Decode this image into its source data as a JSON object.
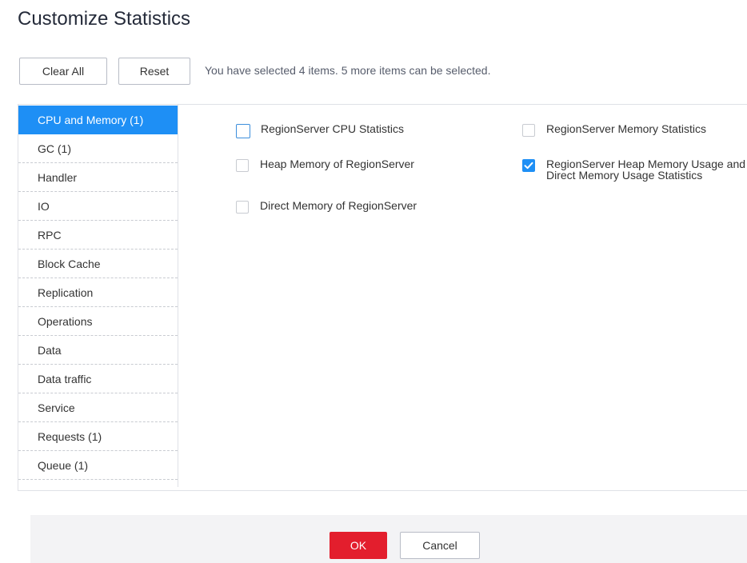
{
  "dialog": {
    "title": "Customize Statistics"
  },
  "toolbar": {
    "clear_all_label": "Clear All",
    "reset_label": "Reset",
    "selection_info": "You have selected 4 items. 5 more items can be selected."
  },
  "categories": [
    {
      "label": "CPU and Memory (1)",
      "selected": true
    },
    {
      "label": "GC (1)",
      "selected": false
    },
    {
      "label": "Handler",
      "selected": false
    },
    {
      "label": "IO",
      "selected": false
    },
    {
      "label": "RPC",
      "selected": false
    },
    {
      "label": "Block Cache",
      "selected": false
    },
    {
      "label": "Replication",
      "selected": false
    },
    {
      "label": "Operations",
      "selected": false
    },
    {
      "label": "Data",
      "selected": false
    },
    {
      "label": "Data traffic",
      "selected": false
    },
    {
      "label": "Service",
      "selected": false
    },
    {
      "label": "Requests (1)",
      "selected": false
    },
    {
      "label": "Queue (1)",
      "selected": false
    }
  ],
  "options": [
    {
      "label": "RegionServer CPU Statistics",
      "checked": false
    },
    {
      "label": "RegionServer Memory Statistics",
      "checked": false
    },
    {
      "label": "Heap Memory of RegionServer",
      "checked": false
    },
    {
      "label": "RegionServer Heap Memory Usage and Direct Memory Usage Statistics",
      "checked": true
    },
    {
      "label": "Direct Memory of RegionServer",
      "checked": false
    }
  ],
  "footer": {
    "ok_label": "OK",
    "cancel_label": "Cancel"
  },
  "colors": {
    "accent": "#1e8ff5",
    "primary_button": "#e31e2d"
  },
  "icons": {
    "checked": "checkmark-icon"
  }
}
